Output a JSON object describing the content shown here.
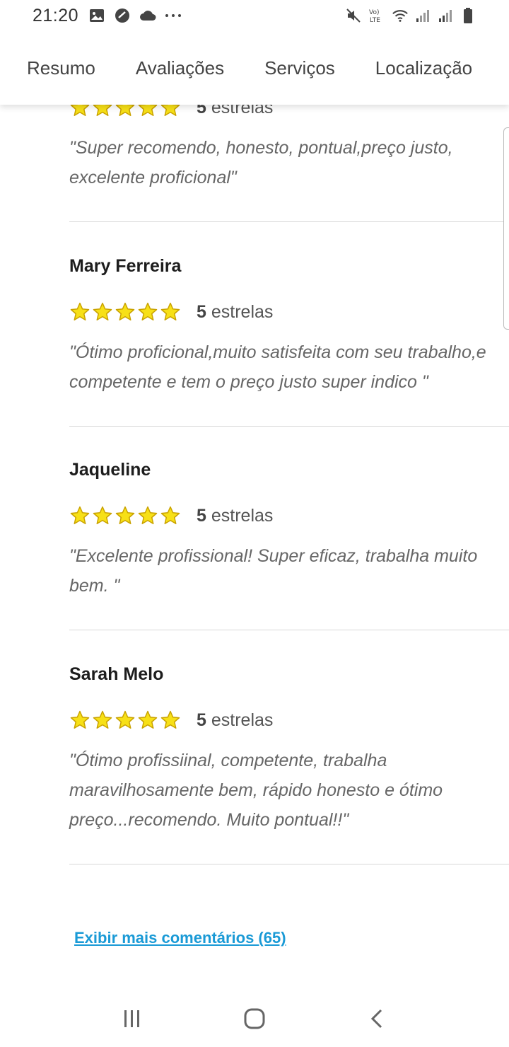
{
  "status_bar": {
    "time": "21:20",
    "left_icons": [
      "image-icon",
      "messenger-icon",
      "cloud-icon",
      "more-dots-icon"
    ],
    "right_icons": [
      "mute-icon",
      "volte-icon",
      "wifi-icon",
      "signal-icon",
      "signal-icon",
      "battery-icon"
    ],
    "volte_label": "VoLTE"
  },
  "tabs": [
    {
      "label": "Resumo"
    },
    {
      "label": "Avaliações"
    },
    {
      "label": "Serviços"
    },
    {
      "label": "Localização"
    }
  ],
  "reviews": [
    {
      "name": "",
      "stars": 5,
      "rating_number": "5",
      "rating_unit": "estrelas",
      "text": "\"Super recomendo, honesto, pontual,preço justo, excelente proficional\""
    },
    {
      "name": "Mary Ferreira",
      "stars": 5,
      "rating_number": "5",
      "rating_unit": "estrelas",
      "text": "\"Ótimo proficional,muito satisfeita com seu trabalho,e competente e tem o preço justo super indico \""
    },
    {
      "name": "Jaqueline",
      "stars": 5,
      "rating_number": "5",
      "rating_unit": "estrelas",
      "text": "\"Excelente profissional! Super eficaz, trabalha muito bem. \""
    },
    {
      "name": "Sarah Melo",
      "stars": 5,
      "rating_number": "5",
      "rating_unit": "estrelas",
      "text": "\"Ótimo profissiinal, competente, trabalha maravilhosamente bem, rápido honesto e ótimo preço...recomendo. Muito pontual!!\""
    }
  ],
  "more_link": "Exibir mais comentários (65)",
  "colors": {
    "star_fill": "#f7e017",
    "star_stroke": "#c9a200",
    "link": "#1a9ad6"
  },
  "nav_bar": [
    "recent-apps-icon",
    "home-icon",
    "back-icon"
  ]
}
